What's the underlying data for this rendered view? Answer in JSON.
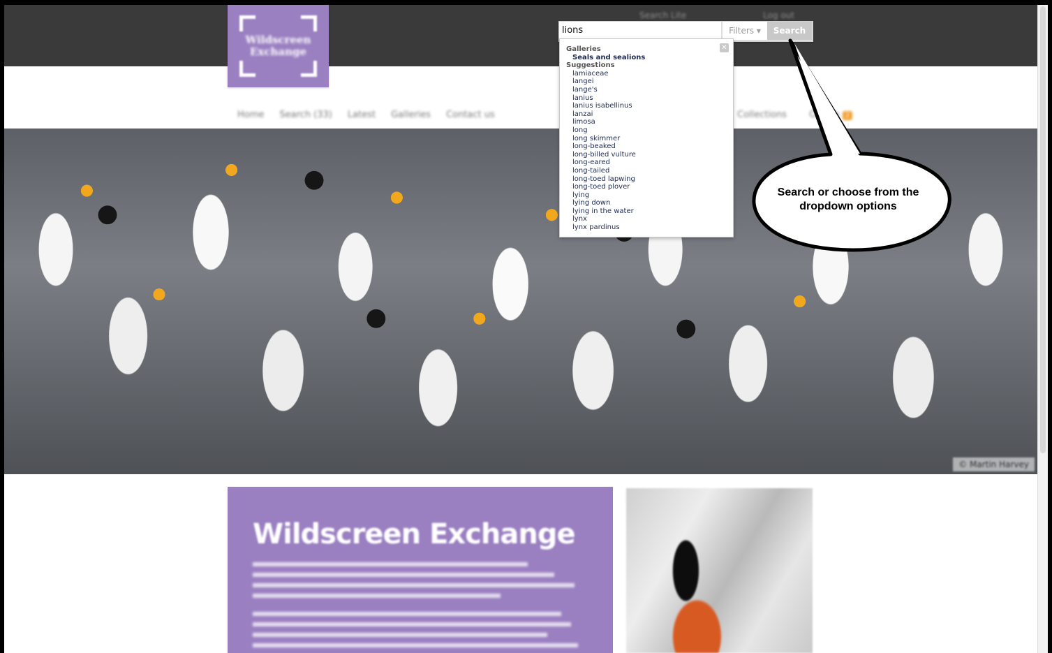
{
  "site": {
    "logo_text": "Wildscreen Exchange",
    "top_links": [
      "Search Lite",
      "Log out"
    ],
    "nav": [
      "Home",
      "Search (33)",
      "Latest",
      "Galleries",
      "Contact us"
    ],
    "nav_right": [
      "Collections",
      "Orders"
    ],
    "orders_count": "2"
  },
  "search": {
    "value": "lions",
    "filters_label": "Filters",
    "button_label": "Search"
  },
  "dropdown": {
    "close_glyph": "✕",
    "galleries_heading": "Galleries",
    "galleries": [
      "Seals and sealions"
    ],
    "suggestions_heading": "Suggestions",
    "suggestions": [
      "lamiaceae",
      "langei",
      "lange's",
      "lanius",
      "lanius isabellinus",
      "lanzai",
      "limosa",
      "long",
      "long skimmer",
      "long-beaked",
      "long-billed vulture",
      "long-eared",
      "long-tailed",
      "long-toed lapwing",
      "long-toed plover",
      "lying",
      "lying down",
      "lying in the water",
      "lynx",
      "lynx pardinus"
    ]
  },
  "hero": {
    "credit": "© Martin Harvey"
  },
  "about": {
    "title": "Wildscreen Exchange"
  },
  "callout": {
    "text": "Search or choose from the dropdown options"
  },
  "colors": {
    "brand_purple": "#9a7fc1",
    "topbar": "#3a3a3a",
    "accent_orange": "#f0a030"
  }
}
